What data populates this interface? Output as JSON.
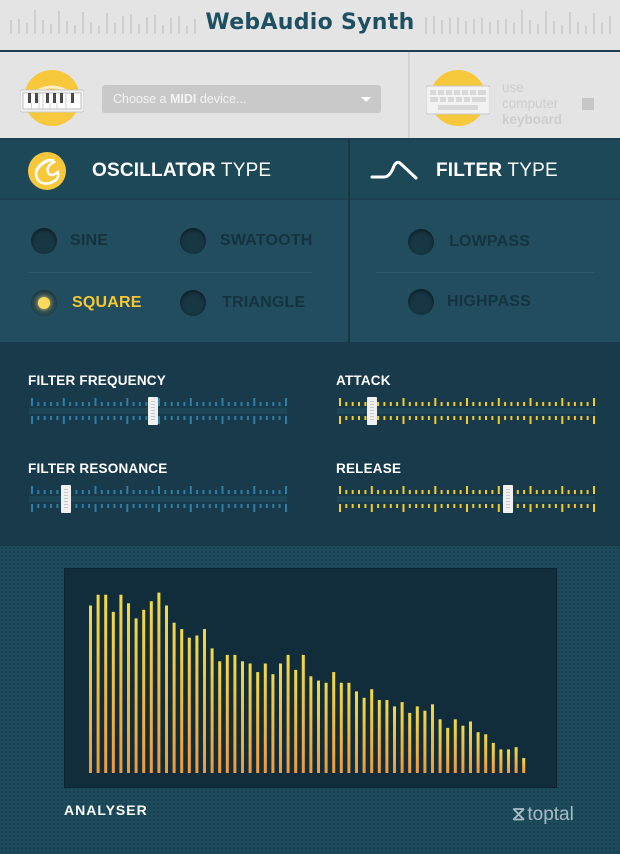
{
  "app": {
    "title": "WebAudio Synth"
  },
  "midi": {
    "select_prefix": "Choose a ",
    "select_bold": "MIDI",
    "select_suffix": " device...",
    "computer_kbd_line1": "use computer",
    "computer_kbd_line2": "keyboard",
    "computer_kbd_checked": false
  },
  "oscillator": {
    "title_bold": "OSCILLATOR",
    "title_rest": " TYPE",
    "options": [
      {
        "label": "SINE",
        "selected": false
      },
      {
        "label": "SWATOOTH",
        "selected": false
      },
      {
        "label": "SQUARE",
        "selected": true
      },
      {
        "label": "TRIANGLE",
        "selected": false
      }
    ]
  },
  "filter": {
    "title_bold": "FILTER",
    "title_rest": " TYPE",
    "options": [
      {
        "label": "LOWPASS",
        "selected": false
      },
      {
        "label": "HIGHPASS",
        "selected": false
      }
    ]
  },
  "sliders": [
    {
      "label": "FILTER FREQUENCY",
      "value": 0.48,
      "color": "#2e7fa8"
    },
    {
      "label": "ATTACK",
      "value": 0.12,
      "color": "#f2cb2e"
    },
    {
      "label": "FILTER RESONANCE",
      "value": 0.13,
      "color": "#2e7fa8"
    },
    {
      "label": "RELEASE",
      "value": 0.67,
      "color": "#f2cb2e"
    }
  ],
  "analyser": {
    "label": "ANALYSER",
    "levels": [
      0.78,
      0.83,
      0.83,
      0.75,
      0.83,
      0.79,
      0.72,
      0.76,
      0.8,
      0.84,
      0.78,
      0.7,
      0.67,
      0.63,
      0.64,
      0.67,
      0.58,
      0.52,
      0.55,
      0.55,
      0.52,
      0.51,
      0.47,
      0.51,
      0.46,
      0.51,
      0.55,
      0.48,
      0.55,
      0.45,
      0.43,
      0.42,
      0.47,
      0.42,
      0.42,
      0.38,
      0.35,
      0.39,
      0.34,
      0.34,
      0.31,
      0.33,
      0.28,
      0.31,
      0.29,
      0.32,
      0.25,
      0.21,
      0.25,
      0.22,
      0.24,
      0.19,
      0.18,
      0.14,
      0.11,
      0.11,
      0.12,
      0.07
    ],
    "colors": {
      "top": "#f2da42",
      "bottom": "#ef9a3c"
    }
  },
  "brand": {
    "mark": "⧖",
    "name": "toptal"
  }
}
